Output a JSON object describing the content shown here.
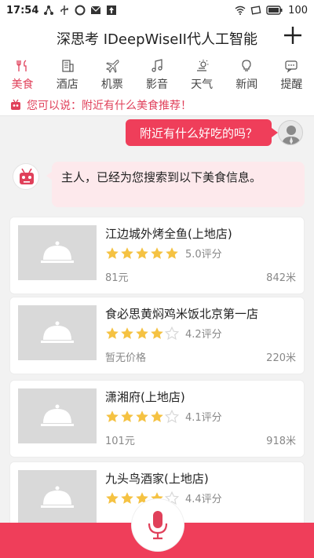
{
  "status_bar": {
    "time": "17:54",
    "battery": "100"
  },
  "header": {
    "title": "深思考 IDeepWiseII代人工智能",
    "add_icon": "plus-icon"
  },
  "tabs": [
    {
      "label": "美食",
      "icon": "food-icon",
      "active": true
    },
    {
      "label": "酒店",
      "icon": "hotel-icon",
      "active": false
    },
    {
      "label": "机票",
      "icon": "plane-icon",
      "active": false
    },
    {
      "label": "影音",
      "icon": "music-icon",
      "active": false
    },
    {
      "label": "天气",
      "icon": "weather-icon",
      "active": false
    },
    {
      "label": "新闻",
      "icon": "news-icon",
      "active": false
    },
    {
      "label": "提醒",
      "icon": "reminder-icon",
      "active": false
    }
  ],
  "hint": {
    "text": "您可以说：附近有什么美食推荐！"
  },
  "chat": {
    "user_message": "附近有什么好吃的吗？",
    "bot_message": "主人，已经为您搜索到以下美食信息。"
  },
  "restaurants": [
    {
      "name": "江边城外烤全鱼(上地店)",
      "rating": 5.0,
      "rating_text": "5.0评分",
      "price": "81元",
      "distance": "842米"
    },
    {
      "name": "食必思黄焖鸡米饭北京第一店",
      "rating": 4.2,
      "rating_text": "4.2评分",
      "price": "暂无价格",
      "distance": "220米"
    },
    {
      "name": "潇湘府(上地店)",
      "rating": 4.1,
      "rating_text": "4.1评分",
      "price": "101元",
      "distance": "918米"
    },
    {
      "name": "九头鸟酒家(上地店)",
      "rating": 4.4,
      "rating_text": "4.4评分",
      "price": "",
      "distance": ""
    }
  ],
  "colors": {
    "accent": "#ef3e5a",
    "star": "#f5c242",
    "star_empty": "#d8d8d8"
  },
  "mic_icon": "microphone-icon"
}
